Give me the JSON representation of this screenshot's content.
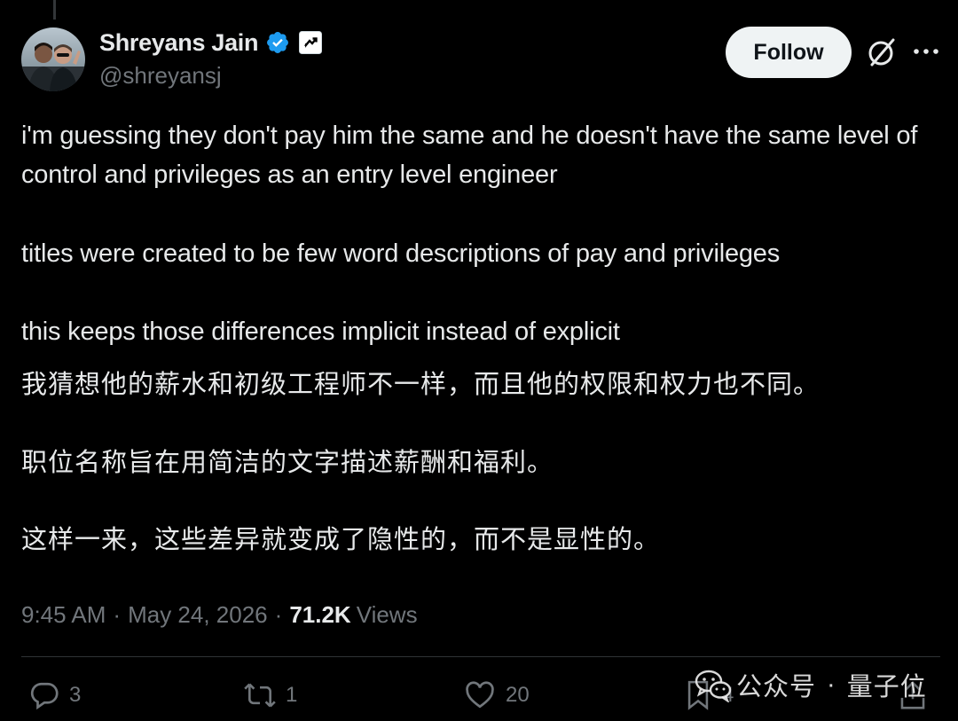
{
  "author": {
    "display_name": "Shreyans Jain",
    "handle": "@shreyansj"
  },
  "header": {
    "follow_label": "Follow"
  },
  "post": {
    "paragraphs_en": [
      "i'm guessing they don't pay him the same and he doesn't have the same level of control and privileges as an entry level engineer",
      "titles were created to be few word descriptions of pay and privileges",
      "this keeps those differences implicit instead of explicit"
    ],
    "paragraphs_cn": [
      "我猜想他的薪水和初级工程师不一样，而且他的权限和权力也不同。",
      "职位名称旨在用简洁的文字描述薪酬和福利。",
      "这样一来，这些差异就变成了隐性的，而不是显性的。"
    ]
  },
  "meta": {
    "time": "9:45 AM",
    "separator": "·",
    "date": "May 24, 2026",
    "views_count": "71.2K",
    "views_label": "Views"
  },
  "actions": {
    "replies": "3",
    "reposts": "1",
    "likes": "20",
    "bookmarks": "4"
  },
  "watermark": {
    "text_left": "公众号",
    "dot": "·",
    "text_right": "量子位"
  },
  "colors": {
    "background": "#000000",
    "text_primary": "#e7e9ea",
    "text_secondary": "#71767b",
    "verified_blue": "#1d9bf0",
    "follow_bg": "#eff3f4"
  },
  "icons": {
    "verified": "verified-badge-icon",
    "affiliate": "affiliate-badge-icon",
    "grok": "grok-icon",
    "more": "more-icon",
    "reply": "reply-icon",
    "repost": "repost-icon",
    "like": "heart-icon",
    "bookmark": "bookmark-icon",
    "share": "share-icon",
    "wechat": "wechat-icon"
  }
}
